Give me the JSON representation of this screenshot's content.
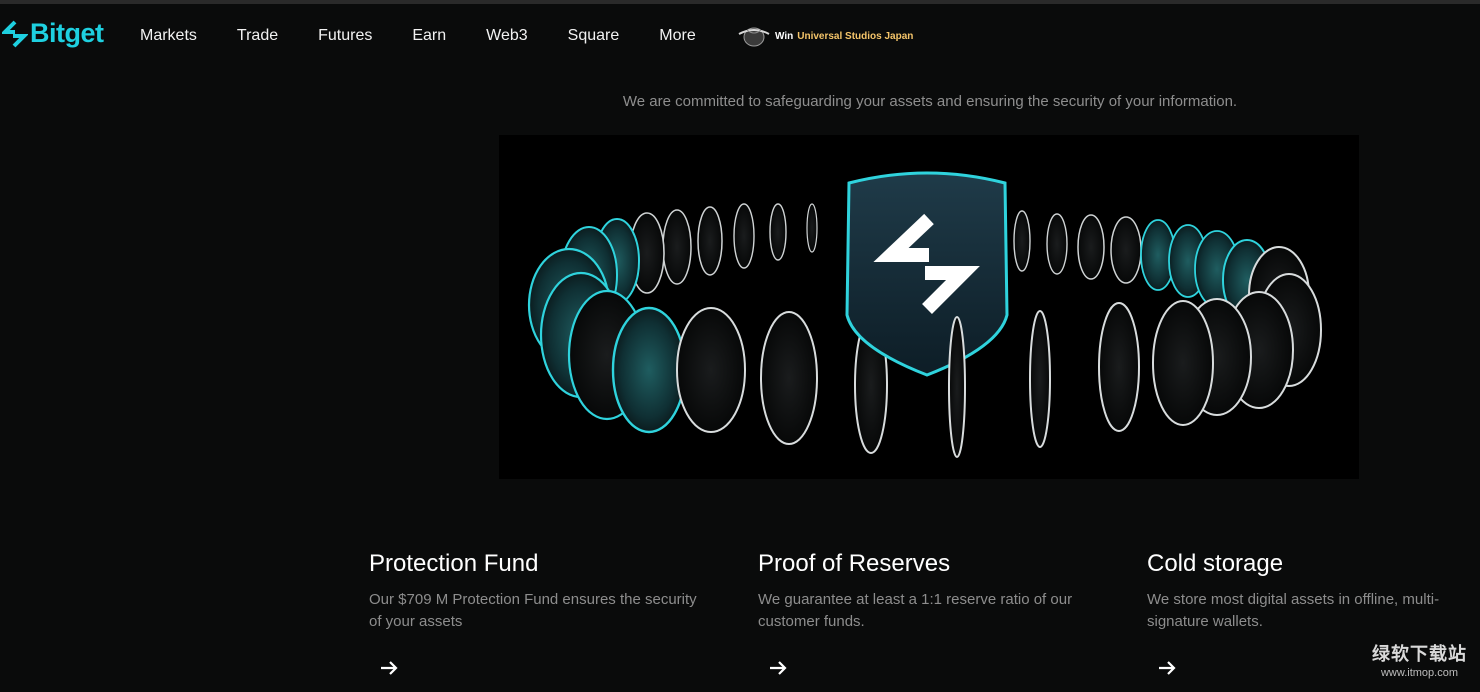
{
  "brand": {
    "name": "Bitget",
    "accent": "#1ed0e0"
  },
  "nav": {
    "items": [
      {
        "label": "Markets"
      },
      {
        "label": "Trade"
      },
      {
        "label": "Futures"
      },
      {
        "label": "Earn"
      },
      {
        "label": "Web3"
      },
      {
        "label": "Square"
      },
      {
        "label": "More"
      }
    ],
    "promo": {
      "win": "Win",
      "name": "Universal Studios Japan"
    }
  },
  "hero": {
    "tagline": "We are committed to safeguarding your assets and ensuring the security of your information."
  },
  "features": [
    {
      "title": "Protection Fund",
      "desc": "Our $709 M Protection Fund ensures the security of your assets",
      "icon": "arrow-right-icon"
    },
    {
      "title": "Proof of Reserves",
      "desc": "We guarantee at least a 1:1 reserve ratio of our customer funds.",
      "icon": "arrow-right-icon"
    },
    {
      "title": "Cold storage",
      "desc": "We store most digital assets in offline, multi-signature wallets.",
      "icon": "arrow-right-icon"
    }
  ],
  "watermark": {
    "cn": "绿软下载站",
    "url": "www.itmop.com"
  }
}
